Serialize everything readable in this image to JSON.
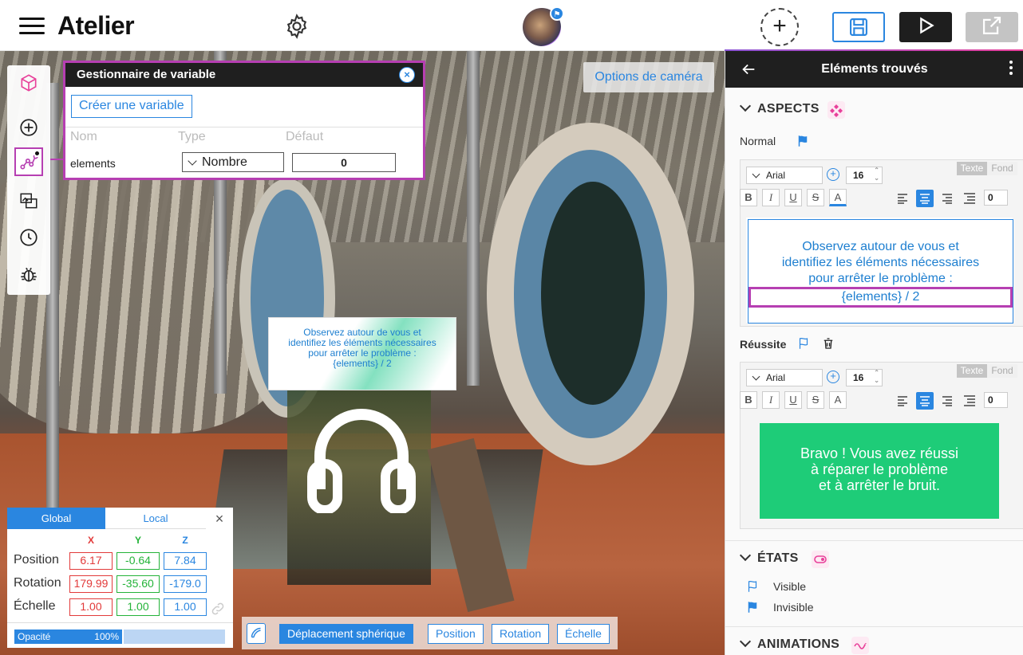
{
  "app": {
    "title": "Atelier"
  },
  "variable_manager": {
    "title": "Gestionnaire de variable",
    "create_label": "Créer une variable",
    "columns": {
      "name": "Nom",
      "type": "Type",
      "default": "Défaut"
    },
    "variables": [
      {
        "name": "elements",
        "type": "Nombre",
        "default": "0"
      }
    ]
  },
  "camera_options_label": "Options de caméra",
  "scene_label": {
    "lines": [
      "Observez autour de vous et",
      "identifiez les éléments nécessaires",
      "pour arrêter le problème :",
      "{elements} / 2"
    ]
  },
  "transform": {
    "tabs": {
      "global": "Global",
      "local": "Local"
    },
    "axes": {
      "x": "X",
      "y": "Y",
      "z": "Z"
    },
    "position": {
      "label": "Position",
      "x": "6.17",
      "y": "-0.64",
      "z": "7.84"
    },
    "rotation": {
      "label": "Rotation",
      "x": "179.99",
      "y": "-35.60",
      "z": "-179.0"
    },
    "scale": {
      "label": "Échelle",
      "x": "1.00",
      "y": "1.00",
      "z": "1.00"
    },
    "opacity": {
      "label": "Opacité",
      "value": "100%"
    }
  },
  "modes": {
    "spherical": "Déplacement sphérique",
    "position": "Position",
    "rotation": "Rotation",
    "scale": "Échelle"
  },
  "right_panel": {
    "title": "Eléments trouvés",
    "aspects": {
      "title": "ASPECTS",
      "normal": {
        "label": "Normal",
        "font": "Arial",
        "size": "16",
        "tab_text": "Texte",
        "tab_bg": "Fond",
        "spacing": "0",
        "lines": [
          "Observez autour de vous et",
          "identifiez les éléments nécessaires",
          "pour arrêter le problème :",
          "{elements} / 2"
        ]
      },
      "success": {
        "label": "Réussite",
        "font": "Arial",
        "size": "16",
        "tab_text": "Texte",
        "tab_bg": "Fond",
        "spacing": "0",
        "lines": [
          "Bravo ! Vous avez réussi",
          "à réparer le problème",
          "et à arrêter le bruit."
        ]
      }
    },
    "states": {
      "title": "ÉTATS",
      "items": [
        "Visible",
        "Invisible"
      ]
    },
    "animations": {
      "title": "ANIMATIONS"
    }
  },
  "colors": {
    "accent": "#2a86e0",
    "highlight": "#b63fb2",
    "success": "#1ecc78",
    "dark": "#1f1f1f"
  }
}
